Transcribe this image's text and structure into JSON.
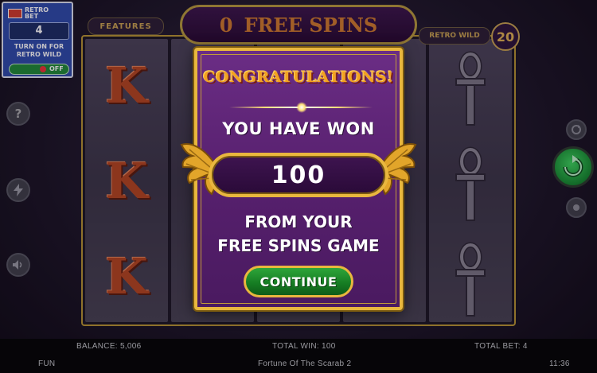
{
  "retro_bet": {
    "logo_line1": "RETRO",
    "logo_line2": "BET",
    "value": "4",
    "caption_line1": "TURN ON FOR",
    "caption_line2": "RETRO WILD",
    "toggle_label": "OFF"
  },
  "header": {
    "features_label": "FEATURES",
    "free_spins_count": "0",
    "free_spins_label": "FREE SPINS",
    "retro_wild_label": "RETRO WILD",
    "counter": "20"
  },
  "reels": {
    "letter_symbol": "K"
  },
  "left_buttons": {
    "help_icon": "?",
    "turbo_icon": "lightning-icon",
    "sound_icon": "speaker-icon"
  },
  "right_buttons": {
    "autoplay_icon": "autoplay-icon",
    "spin_icon": "spin-arrow-icon",
    "stop_icon": "stop-icon"
  },
  "popup": {
    "title": "CONGRATULATIONS!",
    "won_label": "YOU HAVE WON",
    "amount": "100",
    "from_line1": "FROM YOUR",
    "from_line2": "FREE SPINS GAME",
    "continue_label": "CONTINUE"
  },
  "footer": {
    "balance": "BALANCE: 5,006",
    "total_win": "TOTAL WIN: 100",
    "total_bet": "TOTAL BET: 4",
    "mode": "FUN",
    "game_name": "Fortune Of The Scarab 2",
    "clock": "11:36"
  },
  "colors": {
    "gold": "#e9b73e",
    "popup_purple": "#6b2d85",
    "continue_green": "#2ea63a",
    "k_symbol": "#b4441d"
  }
}
